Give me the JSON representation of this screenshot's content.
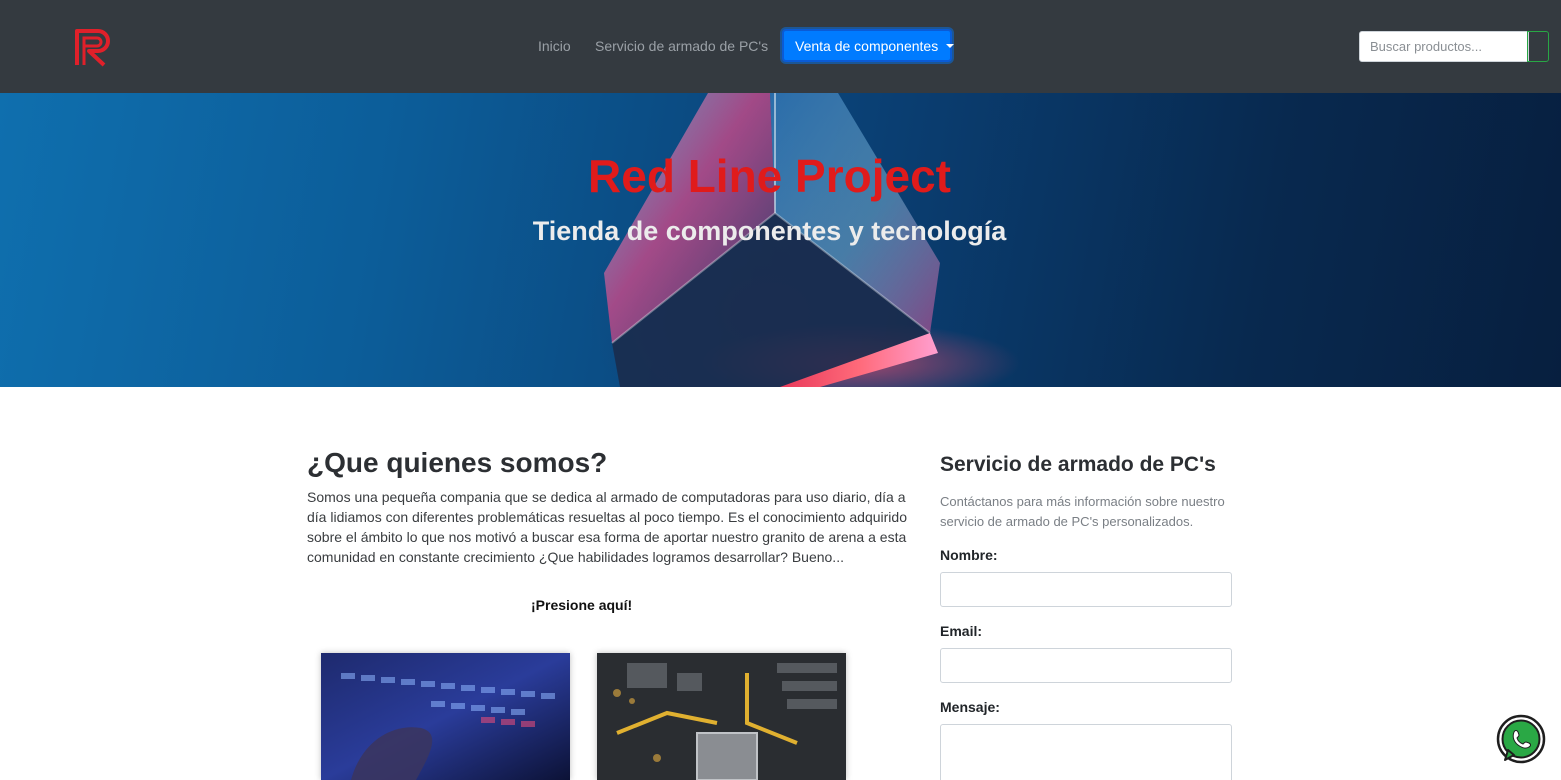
{
  "navbar": {
    "logo_icon": "red-line-r-logo-icon",
    "links": {
      "inicio": "Inicio",
      "armado": "Servicio de armado de PC's",
      "venta": "Venta de componentes"
    },
    "search": {
      "placeholder": "Buscar productos..."
    },
    "colors": {
      "background": "#343a40",
      "active_button": "#007bff",
      "search_button_border": "#28a745"
    }
  },
  "hero": {
    "title": "Red Line Project",
    "subtitle": "Tienda de componentes y tecnología",
    "title_color": "#e01b1b"
  },
  "about": {
    "title": "¿Que quienes somos?",
    "text": "Somos una pequeña compania que se dedica al armado de computadoras para uso diario, día a día lidiamos con diferentes problemáticas resueltas al poco tiempo. Es el conocimiento adquirido sobre el ámbito lo que nos motivó a buscar esa forma de aportar nuestro granito de arena a esta comunidad en constante crecimiento ¿Que habilidades logramos desarrollar? Bueno...",
    "press_link": "¡Presione aquí!",
    "images": [
      "keyboard-photo",
      "motherboard-photo"
    ]
  },
  "contact_form": {
    "title": "Servicio de armado de PC's",
    "description": "Contáctanos para más información sobre nuestro servicio de armado de PC's personalizados.",
    "name_label": "Nombre:",
    "email_label": "Email:",
    "message_label": "Mensaje:"
  },
  "whatsapp_icon": "whatsapp-icon"
}
